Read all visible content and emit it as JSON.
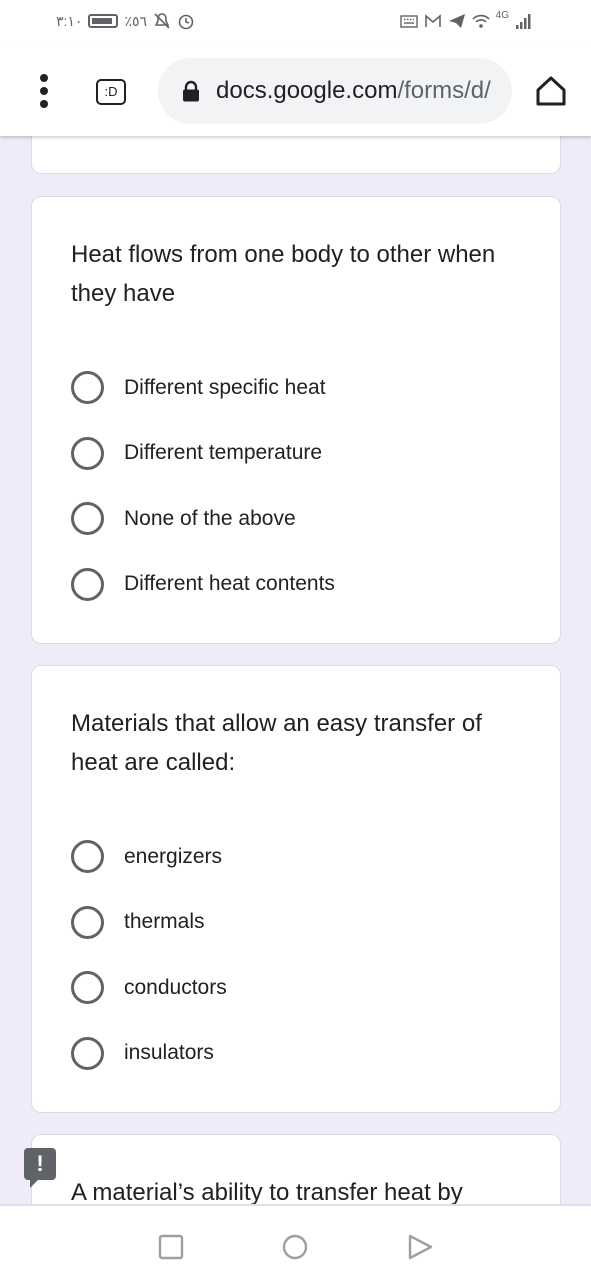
{
  "status_bar": {
    "time": "٣:١٠",
    "battery": "٪٥٦",
    "network": "4G"
  },
  "browser": {
    "tab_badge": ":D",
    "url_domain": "docs.google.com",
    "url_path": "/forms/d/"
  },
  "questions": [
    {
      "text": "Heat flows from one body to other when they have",
      "options": [
        "Different specific heat",
        "Different temperature",
        "None of the above",
        "Different heat contents"
      ]
    },
    {
      "text": "Materials that allow an easy transfer of heat are called:",
      "options": [
        "energizers",
        "thermals",
        "conductors",
        "insulators"
      ]
    },
    {
      "text": "A material’s ability to transfer heat by"
    }
  ],
  "feedback": {
    "label": "!"
  },
  "colors": {
    "background": "#f0ebf8",
    "card": "#ffffff",
    "radio": "#5f6368",
    "text": "#202124"
  },
  "icons": {
    "menu": "more-vertical-icon",
    "lock": "lock-icon",
    "home": "home-icon",
    "recents": "square-recents-icon",
    "nav_home": "circle-home-icon",
    "back": "triangle-back-icon"
  }
}
